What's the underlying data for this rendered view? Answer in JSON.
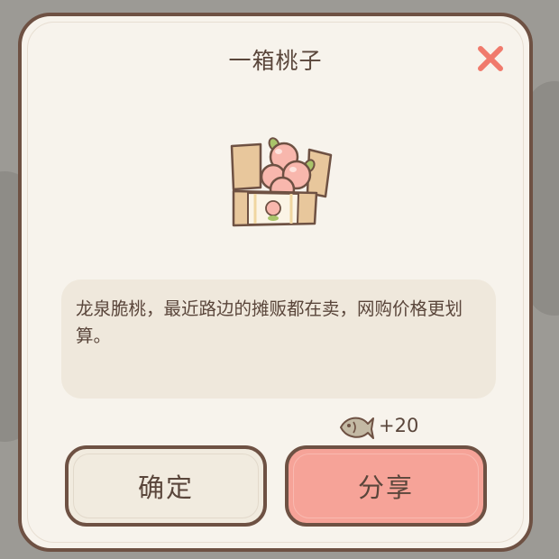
{
  "dialog": {
    "title": "一箱桃子",
    "description": "龙泉脆桃，最近路边的摊贩都在卖，网购价格更划算。",
    "reward": {
      "icon": "fish-icon",
      "amount": "+20"
    },
    "buttons": {
      "confirm_label": "确定",
      "share_label": "分享"
    },
    "item_icon": "peach-box-icon"
  },
  "colors": {
    "border": "#6e5143",
    "panel": "#f7f3ec",
    "close": "#f07a6c",
    "share_button": "#f6a398",
    "confirm_button": "#f1ebdf",
    "text": "#5a463b"
  }
}
